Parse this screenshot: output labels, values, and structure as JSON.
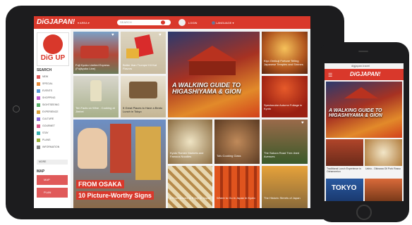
{
  "colors": {
    "accent": "#d9382b",
    "device": "#1c1c1e"
  },
  "tablet": {
    "logo": "DiGJAPAN!",
    "area_label": "AREA",
    "search_placeholder": "SEARCH",
    "login_label": "LOGIN",
    "language_label": "LANGUAGE",
    "sidebar": {
      "digup": "DiG UP",
      "search_heading": "SEARCH",
      "categories": [
        "NEW",
        "SPECIAL",
        "EVENTS",
        "SHOPPING",
        "SIGHTSEEING",
        "EXPERIENCE",
        "CULTURE",
        "GOURMET",
        "STAY",
        "PLANS",
        "INFORMATION"
      ],
      "more_label": "MORE",
      "map_heading": "MAP",
      "map_button": "MAP",
      "plan_button": "PLAN"
    },
    "cards": {
      "train": "Fuji Kyuko Limited Express (Fujikyuko Line)",
      "kitkat": "Better than Trumps! Kit Kat Flavors",
      "lanterns": "Kiyo Omikuji Fortune Telling Japanese Temples and Shrines",
      "hero_title": "A WALKING GUIDE TO HIGASHIYAMA & GION",
      "sake": "Ten Facts on Wine - Cooking at Jimbei",
      "bento": "5 Great Places to Have a Bento Lunch in Tokyo",
      "autumn": "Spectacular Autumn Foliage in Kyoto",
      "osaka_line1": "FROM OSAKA",
      "osaka_line2": "10 Picture-Worthy Signs",
      "noodles": "Kyoto Ramen Markets and Famous Noodles",
      "tofu": "Tofu Cooking Class",
      "cherry": "The Sakura Road Tree-lined Avenues",
      "cups": "5 Experiences to Enjoy In Japan",
      "torii": "Where to Go in Japan In Kyoto",
      "street": "The Historic Streets of Japan"
    }
  },
  "phone": {
    "url": "digjapan.travel",
    "logo": "DiGJAPAN!",
    "hero_title": "A WALKING GUIDE TO HIGASHIYAMA & GION",
    "card1": "Traditional Lunch Experience in Ochanomizu",
    "card2": "Ushio - Okinawa Oil Pork Rosso",
    "tokyo": "TOKYO"
  }
}
